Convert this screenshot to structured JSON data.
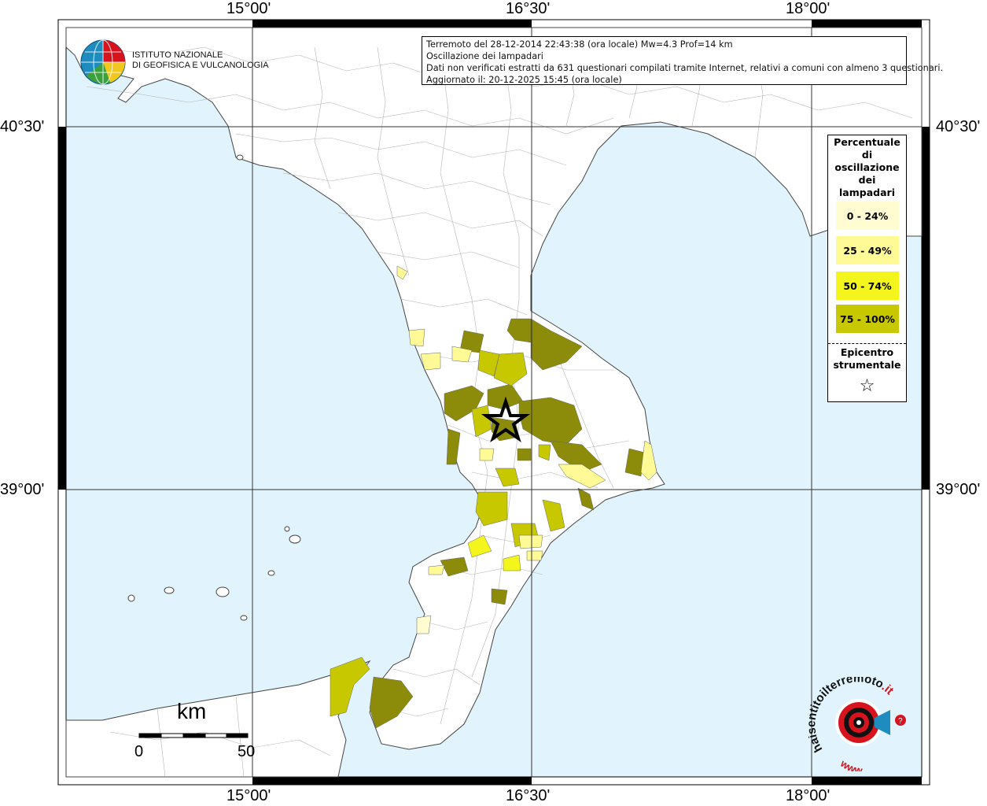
{
  "frame": {
    "lon_labels": [
      "15°00'",
      "16°30'",
      "18°00'"
    ],
    "lat_labels": [
      "40°30'",
      "39°00'"
    ]
  },
  "info": {
    "line1": "Terremoto del 28-12-2014 22:43:38 (ora locale) Mw=4.3 Prof=14 km",
    "line2": "Oscillazione dei lampadari",
    "line3": "Dati non verificati estratti da 631 questionari compilati tramite Internet, relativi a comuni con almeno 3 questionari.",
    "line4": "Aggiornato il: 20-12-2025 15:45 (ora locale)"
  },
  "logo": {
    "line1": "ISTITUTO NAZIONALE",
    "line2": "DI GEOFISICA E VULCANOLOGIA"
  },
  "legend": {
    "title_lines": [
      "Percentuale",
      "di",
      "oscillazione",
      "dei",
      "lampadari"
    ],
    "items": [
      {
        "label": "0 - 24%",
        "color": "#fffcd2"
      },
      {
        "label": "25 - 49%",
        "color": "#fffa96"
      },
      {
        "label": "50 - 74%",
        "color": "#f5f51e"
      },
      {
        "label": "75 - 100%",
        "color": "#c8c800"
      }
    ],
    "epicenter_lines": [
      "Epicentro",
      "strumentale"
    ],
    "epicenter_symbol": "☆"
  },
  "scale": {
    "unit": "km",
    "start": "0",
    "end": "50"
  },
  "watermark": {
    "text_main": "haisentitoilterremoto",
    "text_tld": ".it",
    "text_www": "www."
  },
  "colors": {
    "sea": "#e1f3fc",
    "land": "#ffffff",
    "border": "#9a9a9a",
    "olive": "#8c8c0a",
    "mid": "#c8c800",
    "yellow": "#f5f51e",
    "pale": "#fffa96",
    "palest": "#fffcd2",
    "accent_red": "#d7141e"
  }
}
